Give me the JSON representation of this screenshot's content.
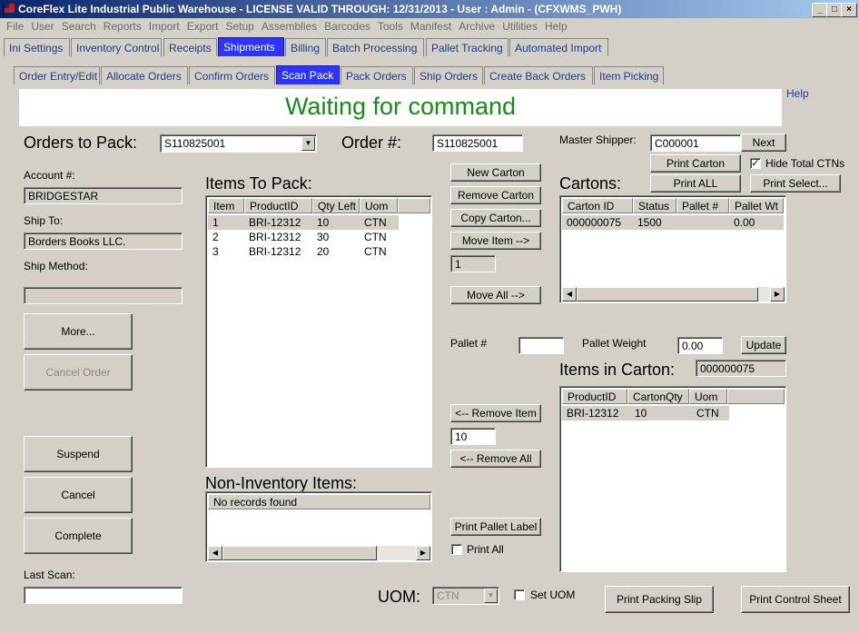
{
  "window": {
    "title": "CoreFlex Lite Industrial Public Warehouse - LICENSE VALID THROUGH: 12/31/2013 - User : Admin - (CFXWMS_PWH)",
    "min": "_",
    "max": "□",
    "close": "×"
  },
  "menu": [
    "File",
    "User",
    "Search",
    "Reports",
    "Import",
    "Export",
    "Setup",
    "Assemblies",
    "Barcodes",
    "Tools",
    "Manifest",
    "Archive",
    "Utilities",
    "Help"
  ],
  "main_tabs": [
    "Ini Settings",
    "Inventory Control",
    "Receipts",
    "Shipments",
    "Billing",
    "Batch Processing",
    "Pallet Tracking",
    "Automated Import"
  ],
  "sub_tabs": [
    "Order Entry/Edit",
    "Allocate Orders",
    "Confirm Orders",
    "Scan Pack",
    "Pack Orders",
    "Ship Orders",
    "Create Back Orders",
    "Item Picking"
  ],
  "status_message": "Waiting for command",
  "help_link": "Help",
  "orders_to_pack": {
    "label": "Orders to Pack:",
    "value": "S110825001"
  },
  "order_no": {
    "label": "Order #:",
    "value": "S110825001"
  },
  "account": {
    "label": "Account #:",
    "value": "BRIDGESTAR"
  },
  "ship_to": {
    "label": "Ship To:",
    "value": "Borders Books LLC."
  },
  "ship_method": {
    "label": "Ship Method:",
    "value": ""
  },
  "left_buttons": {
    "more": "More...",
    "cancel_order": "Cancel Order",
    "suspend": "Suspend",
    "cancel": "Cancel",
    "complete": "Complete"
  },
  "last_scan": {
    "label": "Last Scan:",
    "value": ""
  },
  "items_to_pack": {
    "title": "Items To Pack:",
    "columns": [
      "Item",
      "ProductID",
      "Qty Left",
      "Uom"
    ],
    "rows": [
      [
        "1",
        "BRI-12312",
        "10",
        "CTN"
      ],
      [
        "2",
        "BRI-12312",
        "30",
        "CTN"
      ],
      [
        "3",
        "BRI-12312",
        "20",
        "CTN"
      ]
    ]
  },
  "non_inventory": {
    "title": "Non-Inventory Items:",
    "empty": "No records found"
  },
  "middle_buttons": {
    "new_carton": "New Carton",
    "remove_carton": "Remove Carton",
    "copy_carton": "Copy Carton...",
    "move_item": "Move Item -->",
    "move_qty": "1",
    "move_all": "Move All  -->",
    "remove_item": "<-- Remove Item",
    "remove_qty": "10",
    "remove_all": "<-- Remove All",
    "print_pallet_label": "Print Pallet Label",
    "print_all_check": "Print All"
  },
  "master_shipper": {
    "label": "Master Shipper:",
    "value": "C000001",
    "next": "Next"
  },
  "carton_buttons": {
    "print_carton": "Print Carton",
    "hide_total": "Hide Total CTNs",
    "print_all": "Print ALL",
    "print_select": "Print Select..."
  },
  "cartons": {
    "title": "Cartons:",
    "columns": [
      "Carton ID",
      "Status",
      "Pallet #",
      "Pallet Wt"
    ],
    "rows": [
      [
        "000000075",
        "1500",
        "",
        "0.00"
      ]
    ]
  },
  "pallet": {
    "label": "Pallet #",
    "value": "",
    "weight_label": "Pallet Weight",
    "weight_value": "0.00",
    "update": "Update"
  },
  "items_in_carton": {
    "title": "Items in Carton:",
    "carton_id": "000000075",
    "columns": [
      "ProductID",
      "CartonQty",
      "Uom"
    ],
    "rows": [
      [
        "BRI-12312",
        "10",
        "CTN"
      ]
    ]
  },
  "uom": {
    "label": "UOM:",
    "value": "CTN",
    "set_uom": "Set UOM"
  },
  "bottom_buttons": {
    "print_packing_slip": "Print Packing Slip",
    "print_control_sheet": "Print Control Sheet"
  },
  "colors": {
    "title_bar": "#0a246a",
    "active_tab": "#2d34ff",
    "status_text": "#1a8a1a",
    "tab_text": "#1a3f8a"
  }
}
